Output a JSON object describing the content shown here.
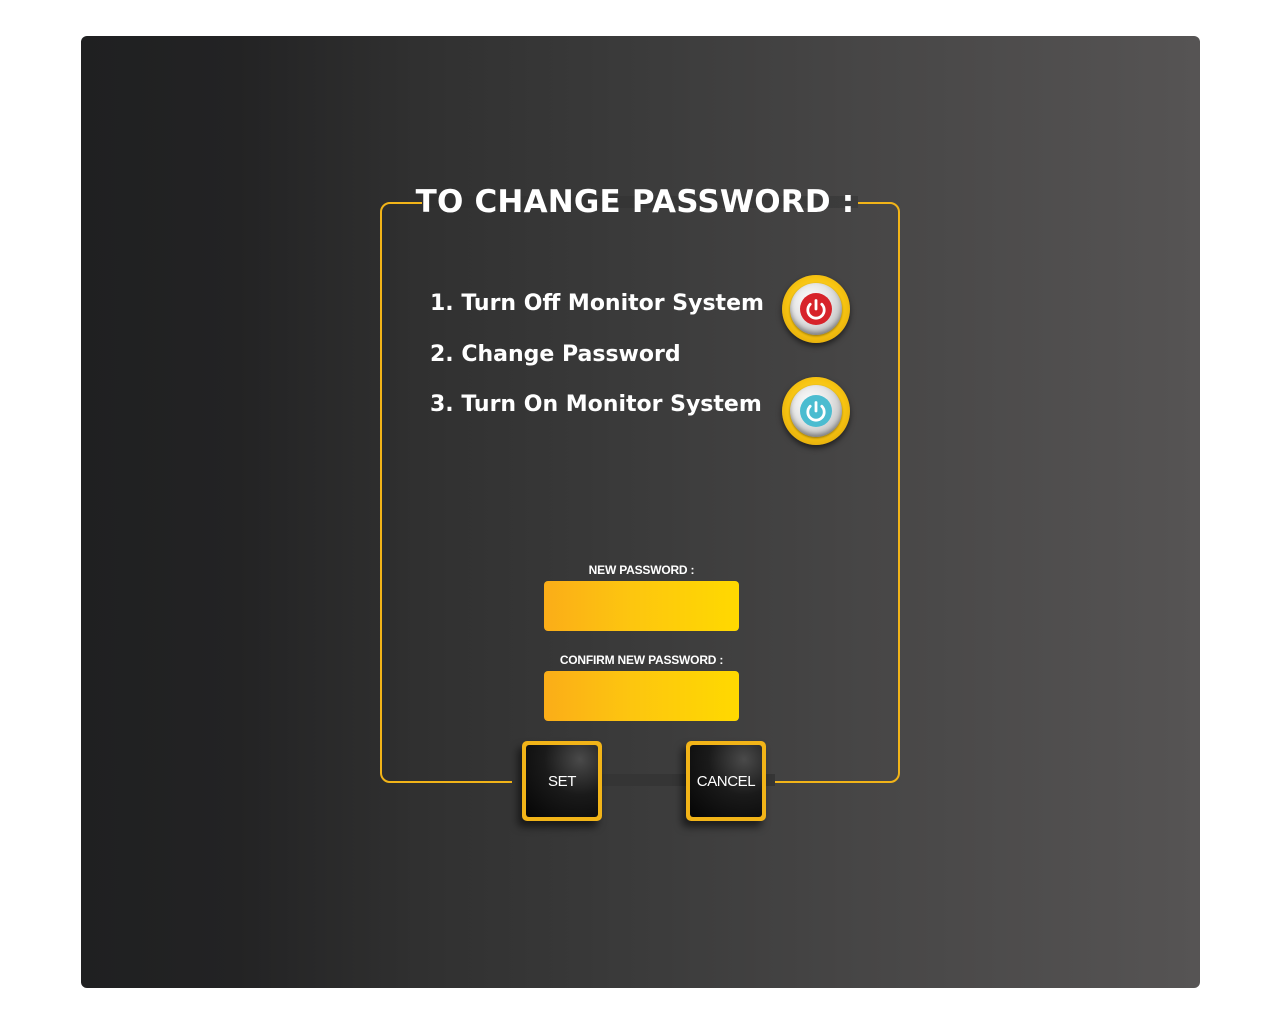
{
  "dialog": {
    "title": "TO CHANGE PASSWORD :"
  },
  "steps": [
    {
      "label": "1. Turn Off Monitor System",
      "icon": "power-off-icon",
      "color": "#d7232a"
    },
    {
      "label": "2. Change Password"
    },
    {
      "label": "3. Turn On Monitor System",
      "icon": "power-on-icon",
      "color": "#3fb6cc"
    }
  ],
  "form": {
    "new_password_label": "NEW PASSWORD :",
    "new_password_value": "",
    "confirm_password_label": "CONFIRM NEW PASSWORD :",
    "confirm_password_value": ""
  },
  "buttons": {
    "set_label": "SET",
    "cancel_label": "CANCEL"
  },
  "colors": {
    "accent": "#f2b418",
    "field_gradient_start": "#fbad18",
    "field_gradient_end": "#ffd900",
    "text": "#ffffff"
  }
}
